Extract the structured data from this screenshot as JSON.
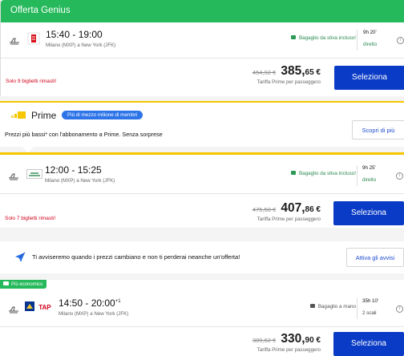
{
  "card1": {
    "badge": "Offerta Genius",
    "time": "15:40 - 19:00",
    "route": "Milano (MXP)  a  New York (JFK)",
    "baggage": "Bagaglio da stiva incluso!",
    "duration": "9h 20'",
    "stops": "diretto",
    "old_price": "454,92 €",
    "price_main": "385,",
    "price_cents": "65 €",
    "fare_note": "Tariffa Prime per passeggero",
    "tickets_left": "Solo 9 biglietti rimasti!",
    "select_label": "Seleziona",
    "info": "i"
  },
  "prime": {
    "word": "Prime",
    "pill": "Più di mezzo milione di membri",
    "text": "Prezzi più bassi* con l'abbonamento a Prime. Senza sorprese",
    "discover": "Scopri di più"
  },
  "card2": {
    "airline_code": "MPA",
    "time": "12:00 - 15:25",
    "route": "Milano (MXP)  a  New York (JFK)",
    "baggage": "Bagaglio da stiva incluso!",
    "duration": "9h 25'",
    "stops": "diretto",
    "old_price": "475,50 €",
    "price_main": "407,",
    "price_cents": "86 €",
    "fare_note": "Tariffa Prime per passeggero",
    "tickets_left": "Solo 7 biglietti rimasti!",
    "select_label": "Seleziona",
    "info": "i"
  },
  "alert": {
    "text": "Ti avviseremo quando i prezzi cambiano e non ti perderai neanche un'offerta!",
    "button": "Attiva gli avvisi"
  },
  "card3": {
    "badge": "Più economico",
    "time_main": "14:50 - 20:00",
    "time_sup": "+1",
    "route": "Milano (MXP)  a  New York (JFK)",
    "baggage": "Bagaglio a mano",
    "duration": "35h 10'",
    "stops": "2 scali",
    "tap_logo": "TAP",
    "old_price": "389,62 €",
    "price_main": "330,",
    "price_cents": "90 €",
    "fare_note": "Tariffa Prime per passeggero",
    "select_label": "Seleziona",
    "info": "i"
  },
  "colors": {
    "genius_green": "#25b95b",
    "select_blue": "#0a3bc6",
    "prime_yellow": "#f6c600",
    "pill_blue": "#2d74e8",
    "warning_red": "#d0021b"
  },
  "icons": [
    "plane-icon",
    "airline-logo",
    "baggage-icon",
    "info-icon",
    "prime-logo",
    "alert-bell-icon",
    "tag-icon"
  ]
}
